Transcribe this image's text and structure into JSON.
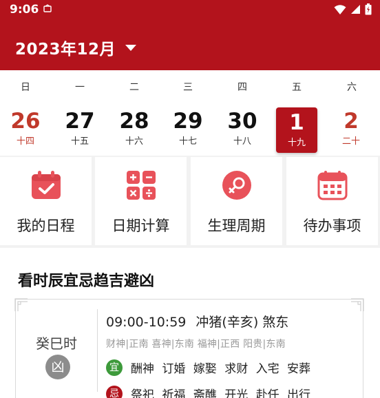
{
  "status_bar": {
    "time": "9:06"
  },
  "header": {
    "month_title": "2023年12月"
  },
  "weekdays": [
    "日",
    "一",
    "二",
    "三",
    "四",
    "五",
    "六"
  ],
  "days": [
    {
      "num": "26",
      "lunar": "十四"
    },
    {
      "num": "27",
      "lunar": "十五"
    },
    {
      "num": "28",
      "lunar": "十六"
    },
    {
      "num": "29",
      "lunar": "十七"
    },
    {
      "num": "30",
      "lunar": "十八"
    },
    {
      "num": "1",
      "lunar": "十九"
    },
    {
      "num": "2",
      "lunar": "二十"
    }
  ],
  "selected_day_index": 5,
  "tools": [
    {
      "label": "我的日程",
      "icon": "calendar-check-icon"
    },
    {
      "label": "日期计算",
      "icon": "calculator-icon"
    },
    {
      "label": "生理周期",
      "icon": "female-cycle-icon"
    },
    {
      "label": "待办事项",
      "icon": "calendar-grid-icon"
    }
  ],
  "almanac": {
    "title": "看时辰宜忌趋吉避凶",
    "shichen": "癸巳时",
    "luck": "凶",
    "hour_range": "09:00-10:59",
    "clash": "冲猪(辛亥) 煞东",
    "gods": "财神|正南 喜神|东南 福神|正西 阳贵|东南",
    "yi_label": "宜",
    "yi": "酬神 订婚 嫁娶 求财 入宅 安葬",
    "ji_label": "忌",
    "ji": "祭祀 祈福 斋醮 开光 赴任 出行"
  },
  "colors": {
    "brand": "#b3131c",
    "icon_red": "#e8525a",
    "yi_green": "#3d9a3b"
  }
}
